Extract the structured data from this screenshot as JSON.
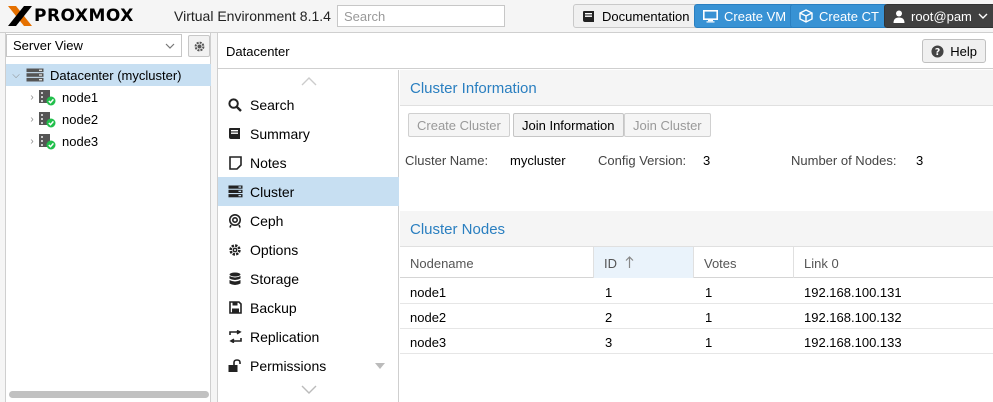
{
  "topbar": {
    "brand": "PROXMOX",
    "product": "Virtual Environment 8.1.4",
    "search_placeholder": "Search",
    "documentation": "Documentation",
    "create_vm": "Create VM",
    "create_ct": "Create CT",
    "user": "root@pam",
    "colors": {
      "accent_blue": "#3892d4",
      "logo_orange": "#e57000",
      "dark_user": "#404040"
    }
  },
  "tree": {
    "view": "Server View",
    "items": [
      {
        "label": "Datacenter (mycluster)",
        "icon": "datacenter-icon",
        "selected": true
      },
      {
        "label": "node1",
        "icon": "server-online-icon"
      },
      {
        "label": "node2",
        "icon": "server-online-icon"
      },
      {
        "label": "node3",
        "icon": "server-online-icon"
      }
    ]
  },
  "content": {
    "title": "Datacenter",
    "help": "Help",
    "nav": [
      {
        "label": "Search",
        "icon": "search-icon"
      },
      {
        "label": "Summary",
        "icon": "book-icon"
      },
      {
        "label": "Notes",
        "icon": "note-icon"
      },
      {
        "label": "Cluster",
        "icon": "server-stack-icon",
        "active": true
      },
      {
        "label": "Ceph",
        "icon": "ceph-icon"
      },
      {
        "label": "Options",
        "icon": "gear-icon"
      },
      {
        "label": "Storage",
        "icon": "database-icon"
      },
      {
        "label": "Backup",
        "icon": "floppy-icon"
      },
      {
        "label": "Replication",
        "icon": "replication-icon"
      },
      {
        "label": "Permissions",
        "icon": "unlock-icon"
      }
    ],
    "cluster_info": {
      "header": "Cluster Information",
      "create_cluster": "Create Cluster",
      "join_information": "Join Information",
      "join_cluster": "Join Cluster",
      "name_label": "Cluster Name:",
      "name_value": "mycluster",
      "config_label": "Config Version:",
      "config_value": "3",
      "nodes_label": "Number of Nodes:",
      "nodes_value": "3"
    },
    "cluster_nodes": {
      "header": "Cluster Nodes",
      "columns": [
        "Nodename",
        "ID",
        "Votes",
        "Link 0"
      ],
      "rows": [
        [
          "node1",
          "1",
          "1",
          "192.168.100.131"
        ],
        [
          "node2",
          "2",
          "1",
          "192.168.100.132"
        ],
        [
          "node3",
          "3",
          "1",
          "192.168.100.133"
        ]
      ]
    }
  }
}
